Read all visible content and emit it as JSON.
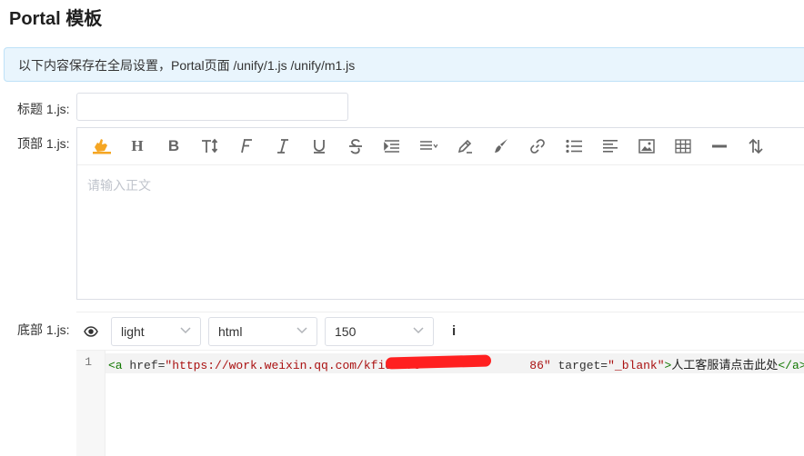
{
  "page": {
    "title": "Portal 模板",
    "info_text": "以下内容保存在全局设置，Portal页面 /unify/1.js /unify/m1.js"
  },
  "form": {
    "title_label": "标题 1.js:",
    "title_value": "",
    "header_label": "顶部 1.js:",
    "footer_label": "底部 1.js:"
  },
  "rich_editor": {
    "placeholder": "请输入正文",
    "toolbar": [
      "emoji-icon",
      "heading-icon",
      "bold-icon",
      "font-size-icon",
      "font-family-icon",
      "italic-icon",
      "underline-icon",
      "strikethrough-icon",
      "indent-icon",
      "line-height-icon",
      "font-color-icon",
      "background-color-icon",
      "link-icon",
      "list-icon",
      "justify-icon",
      "image-icon",
      "table-icon",
      "divider-icon",
      "sort-icon"
    ]
  },
  "code_editor": {
    "theme": "light",
    "mode": "html",
    "height": "150",
    "info_label": "i",
    "line_number": "1",
    "tokens": {
      "open_tag": "<a",
      "href_attr": " href=",
      "href_value_start": "\"https://work.weixin.qq.com/kfid/kfc",
      "href_value_end": "86\"",
      "target_attr": " target=",
      "target_value": "\"_blank\"",
      "tag_close": ">",
      "link_text": "人工客服请点击此处",
      "close_tag": "</a>"
    }
  },
  "colors": {
    "info_bg": "#e9f5fd",
    "info_border": "#bfe2f8",
    "emoji": "#f5a623",
    "redaction": "#ff2020"
  }
}
